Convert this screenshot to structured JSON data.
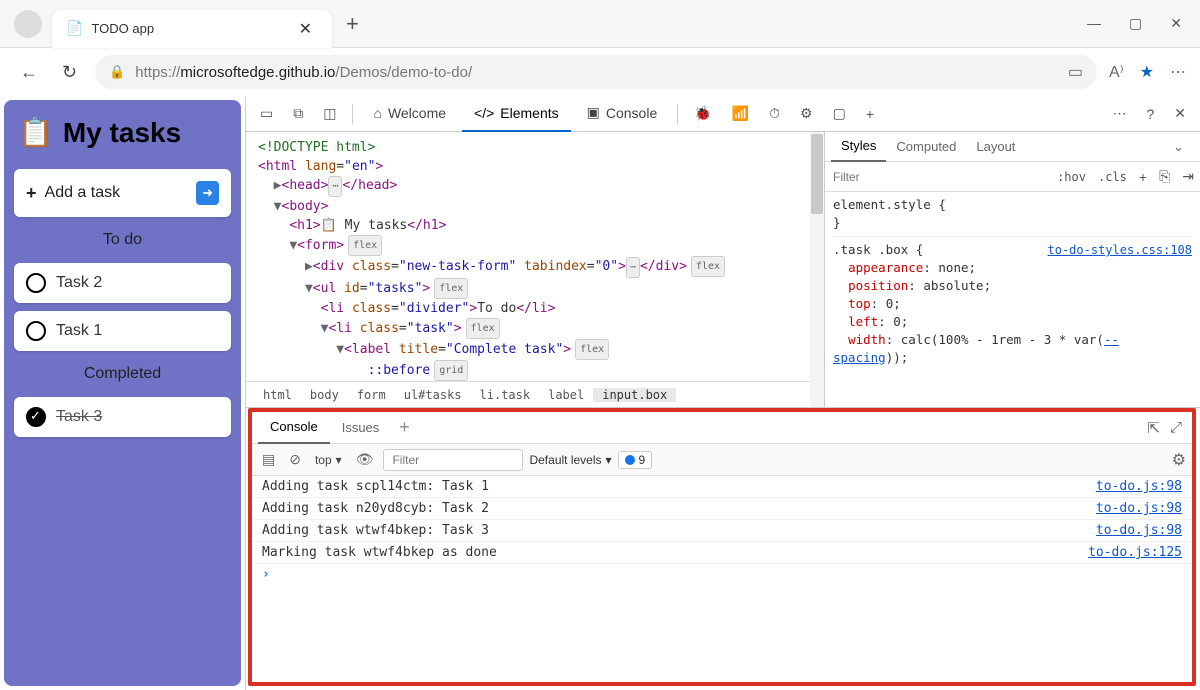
{
  "browser": {
    "tab_title": "TODO app",
    "url_prefix": "https://",
    "url_host": "microsoftedge.github.io",
    "url_path": "/Demos/demo-to-do/"
  },
  "app": {
    "title": "My tasks",
    "add_label": "Add a task",
    "sections": {
      "todo": "To do",
      "completed": "Completed"
    },
    "tasks_todo": [
      "Task 2",
      "Task 1"
    ],
    "tasks_done": [
      "Task 3"
    ]
  },
  "devtools": {
    "tabs": {
      "welcome": "Welcome",
      "elements": "Elements",
      "console": "Console"
    },
    "dom": {
      "doctype": "<!DOCTYPE html>",
      "html_open": "html",
      "html_lang": "en",
      "head": "head",
      "body": "body",
      "h1_text": " My tasks",
      "form": "form",
      "div_class": "new-task-form",
      "div_tabindex": "0",
      "ul_id": "tasks",
      "li_divider_class": "divider",
      "li_divider_text": "To do",
      "li_task_class": "task",
      "label_title": "Complete task",
      "before": "::before",
      "flex_badge": "flex",
      "grid_badge": "grid"
    },
    "breadcrumb": [
      "html",
      "body",
      "form",
      "ul#tasks",
      "li.task",
      "label",
      "input.box"
    ],
    "styles": {
      "tabs": {
        "styles": "Styles",
        "computed": "Computed",
        "layout": "Layout"
      },
      "filter_placeholder": "Filter",
      "hov": ":hov",
      "cls": ".cls",
      "element_style": "element.style {",
      "close_brace": "}",
      "rule_selector": ".task .box {",
      "rule_src": "to-do-styles.css:108",
      "props": {
        "appearance": "appearance",
        "appearance_v": "none",
        "position": "position",
        "position_v": "absolute",
        "top": "top",
        "top_v": "0",
        "left": "left",
        "left_v": "0",
        "width": "width",
        "width_v_pre": "calc(100% - 1rem - 3 * var(",
        "width_var": "--spacing",
        "width_v_post": "));"
      }
    }
  },
  "console": {
    "tabs": {
      "console": "Console",
      "issues": "Issues"
    },
    "toolbar": {
      "top": "top",
      "filter_placeholder": "Filter",
      "levels": "Default levels",
      "issue_count": "9"
    },
    "logs": [
      {
        "msg": "Adding task scpl14ctm: Task 1",
        "src": "to-do.js:98"
      },
      {
        "msg": "Adding task n20yd8cyb: Task 2",
        "src": "to-do.js:98"
      },
      {
        "msg": "Adding task wtwf4bkep: Task 3",
        "src": "to-do.js:98"
      },
      {
        "msg": "Marking task wtwf4bkep as done",
        "src": "to-do.js:125"
      }
    ]
  }
}
